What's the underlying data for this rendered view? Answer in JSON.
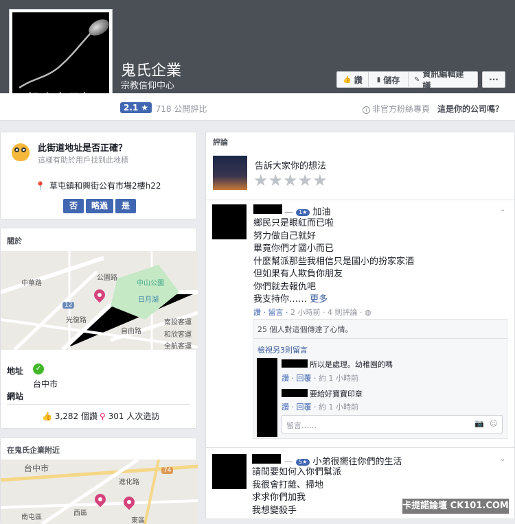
{
  "header": {
    "profile_caption": "想吃自己打",
    "page_name": "鬼氏企業",
    "page_category": "宗教信仰中心",
    "buttons": {
      "like": "讚",
      "save": "儲存",
      "suggest": "資訊編輯建議",
      "more": "···"
    },
    "rating": "2.1 ★",
    "reviews_count": "· 718 公開評比",
    "unofficial": "非官方粉絲專頁",
    "claim": "這是你的公司嗎？"
  },
  "address_card": {
    "question": "此街道地址是否正確？",
    "hint": "這樣有助於用戶找到此地標",
    "address": "草屯鎮和興街公有市場2樓h22",
    "buttons": {
      "no": "否",
      "unsure": "略過",
      "yes": "是"
    }
  },
  "about_card": {
    "title": "關於",
    "map_labels": {
      "street1": "公園路",
      "park": "中山公園",
      "lake": "日月湖",
      "road1": "中華路",
      "road2": "光復路",
      "road3": "自由路",
      "station1": "南投客運",
      "station2": "和欣客運",
      "station3": "全航客運",
      "route": "12"
    },
    "address_label": "地址",
    "city": "台中市",
    "website_label": "網站",
    "likes": "3,282 個讚",
    "visits": "301 人次造訪"
  },
  "nearby_card": {
    "title": "在鬼氏企業附近",
    "map_labels": {
      "city": "台中市",
      "district1": "西區",
      "district2": "南屯區",
      "district3": "東區",
      "road": "進化路",
      "route": "74"
    }
  },
  "reviews": {
    "title": "評論",
    "prompt": "告訴大家你的想法",
    "stars": "★★★★★",
    "post1": {
      "dash": "—",
      "badge": "1★",
      "headline": "加油",
      "lines": [
        "鄉民只是眼紅而已啦",
        "努力做自己就好",
        "畢竟你們才國小而已",
        "什麼幫派那些我相信只是國小的扮家家酒",
        "但如果有人欺負你朋友",
        "你們就去報仇吧",
        "我支持你……"
      ],
      "more": "更多",
      "actions": "讚 · 留言 ·",
      "meta": "2 小時前 · 4 則評論 ·",
      "reactions": "25 個人對這個傳達了心情。",
      "view_more": "檢視另3則留言",
      "reply1_text": "所以是處理。幼稚園的嗎",
      "reply1_actions": "讚 · 回覆 ·",
      "reply1_meta": "約 1 小時前",
      "reply2_text": "要給好寶寶印章",
      "reply2_actions": "讚 · 回覆 ·",
      "reply2_meta": "約 1 小時前",
      "reply_placeholder": "留言……"
    },
    "post2": {
      "dash": "—",
      "badge": "5★",
      "headline": "小弟很嚮往你們的生活",
      "lines": [
        "請問要如何入你們幫派",
        "我很會打雜、掃地",
        "求求你們加我",
        "我想變殺手"
      ]
    }
  },
  "watermark": "卡提諾論壇 CK101.COM"
}
